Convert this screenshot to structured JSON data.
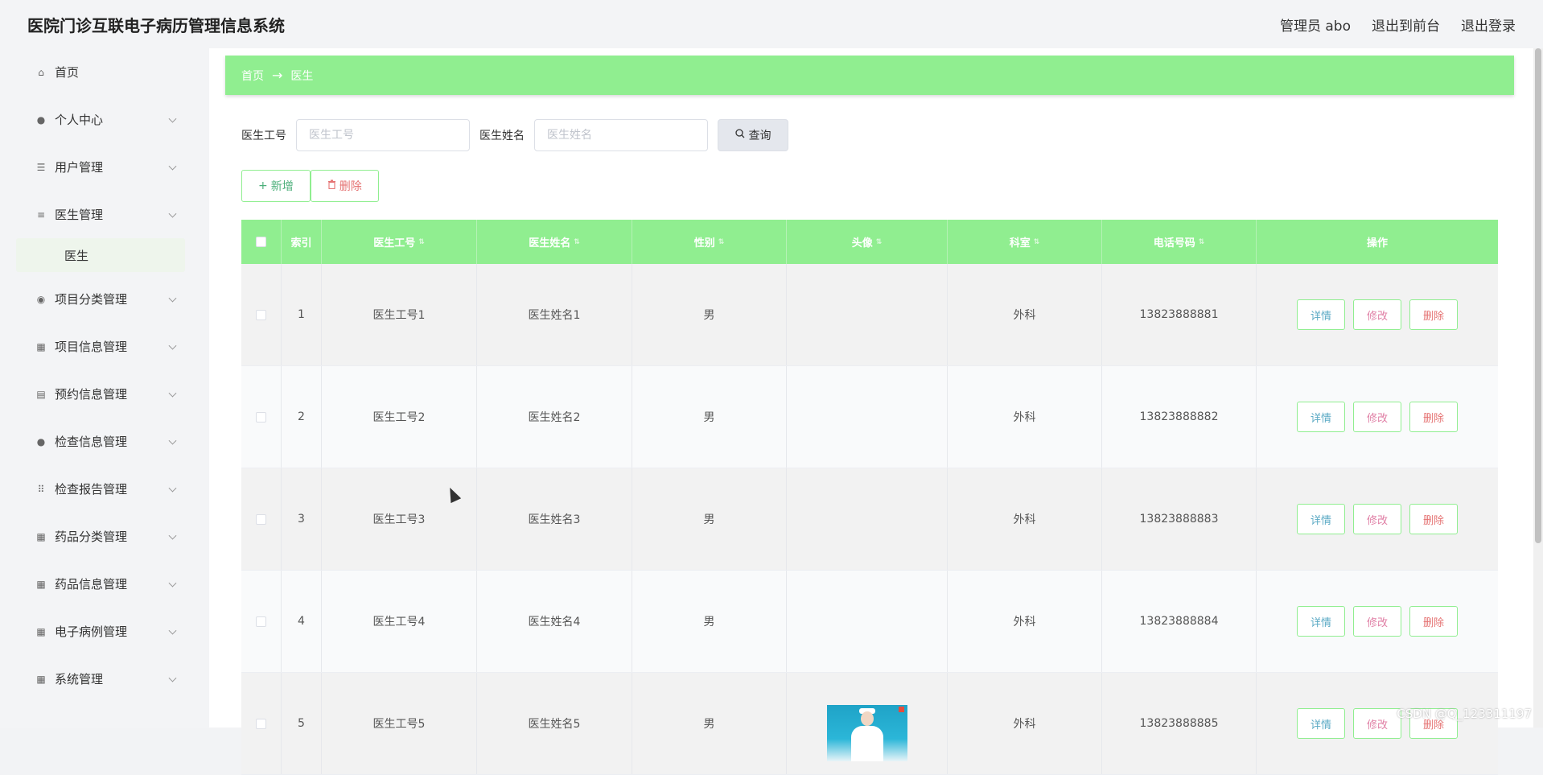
{
  "header": {
    "app_title": "医院门诊互联电子病历管理信息系统",
    "admin_label": "管理员 abo",
    "back_front_label": "退出到前台",
    "logout_label": "退出登录"
  },
  "sidebar": {
    "items": [
      {
        "label": "首页",
        "icon": "home-icon",
        "has_sub": false
      },
      {
        "label": "个人中心",
        "icon": "user-icon",
        "has_sub": true
      },
      {
        "label": "用户管理",
        "icon": "sliders-icon",
        "has_sub": true
      },
      {
        "label": "医生管理",
        "icon": "list-icon",
        "has_sub": true
      },
      {
        "label": "医生",
        "icon": "",
        "has_sub": false,
        "active_sub": true
      },
      {
        "label": "项目分类管理",
        "icon": "location-icon",
        "has_sub": true
      },
      {
        "label": "项目信息管理",
        "icon": "grid-icon",
        "has_sub": true
      },
      {
        "label": "预约信息管理",
        "icon": "clipboard-icon",
        "has_sub": true
      },
      {
        "label": "检查信息管理",
        "icon": "user-icon",
        "has_sub": true
      },
      {
        "label": "检查报告管理",
        "icon": "apps-icon",
        "has_sub": true
      },
      {
        "label": "药品分类管理",
        "icon": "grid-icon",
        "has_sub": true
      },
      {
        "label": "药品信息管理",
        "icon": "grid-icon",
        "has_sub": true
      },
      {
        "label": "电子病例管理",
        "icon": "grid-icon",
        "has_sub": true
      },
      {
        "label": "系统管理",
        "icon": "grid-icon",
        "has_sub": true
      }
    ]
  },
  "breadcrumb": {
    "home": "首页",
    "arrow": "→",
    "current": "医生"
  },
  "search": {
    "doctor_id_label": "医生工号",
    "doctor_id_placeholder": "医生工号",
    "doctor_id_value": "",
    "doctor_name_label": "医生姓名",
    "doctor_name_placeholder": "医生姓名",
    "doctor_name_value": "",
    "query_label": "查询"
  },
  "actions": {
    "add_label": "新增",
    "delete_label": "删除"
  },
  "table": {
    "columns": [
      "",
      "索引",
      "医生工号",
      "医生姓名",
      "性别",
      "头像",
      "科室",
      "电话号码",
      "操作"
    ],
    "rows": [
      {
        "index": "1",
        "doctor_id": "医生工号1",
        "doctor_name": "医生姓名1",
        "gender": "男",
        "has_avatar": false,
        "department": "外科",
        "phone": "13823888881"
      },
      {
        "index": "2",
        "doctor_id": "医生工号2",
        "doctor_name": "医生姓名2",
        "gender": "男",
        "has_avatar": false,
        "department": "外科",
        "phone": "13823888882"
      },
      {
        "index": "3",
        "doctor_id": "医生工号3",
        "doctor_name": "医生姓名3",
        "gender": "男",
        "has_avatar": false,
        "department": "外科",
        "phone": "13823888883"
      },
      {
        "index": "4",
        "doctor_id": "医生工号4",
        "doctor_name": "医生姓名4",
        "gender": "男",
        "has_avatar": false,
        "department": "外科",
        "phone": "13823888884"
      },
      {
        "index": "5",
        "doctor_id": "医生工号5",
        "doctor_name": "医生姓名5",
        "gender": "男",
        "has_avatar": true,
        "department": "外科",
        "phone": "13823888885"
      }
    ],
    "row_buttons": {
      "detail": "详情",
      "edit": "修改",
      "delete": "删除"
    }
  },
  "watermark": "CSDN @Q_123311197",
  "colors": {
    "accent_green": "#90ee90",
    "detail_color": "#5aa9c4",
    "edit_color": "#e07fa5",
    "delete_color": "#e57373"
  }
}
